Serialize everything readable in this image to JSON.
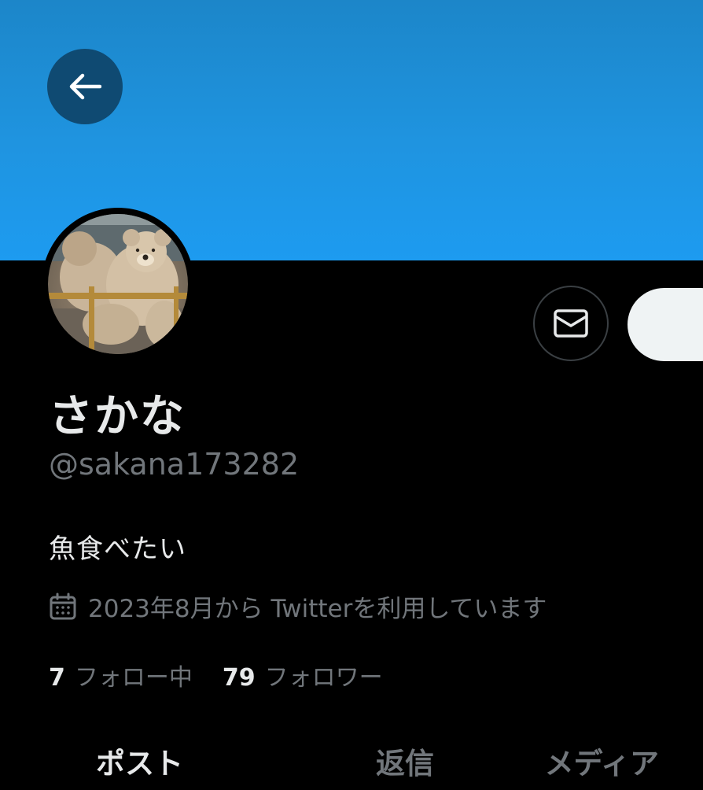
{
  "profile": {
    "display_name": "さかな",
    "handle": "@sakana173282",
    "bio": "魚食べたい",
    "joined": "2023年8月から Twitterを利用しています"
  },
  "stats": {
    "following_count": "7",
    "following_label": "フォロー中",
    "followers_count": "79",
    "followers_label": "フォロワー"
  },
  "tabs": [
    {
      "label": "ポスト",
      "active": true
    },
    {
      "label": "返信",
      "active": false
    },
    {
      "label": "メディア",
      "active": false
    }
  ],
  "icons": {
    "back": "arrow-left-icon",
    "message": "envelope-icon",
    "calendar": "calendar-icon"
  },
  "colors": {
    "banner": "#1d9bf0",
    "background": "#000000",
    "text_primary": "#e7e9ea",
    "text_secondary": "#71767b"
  }
}
